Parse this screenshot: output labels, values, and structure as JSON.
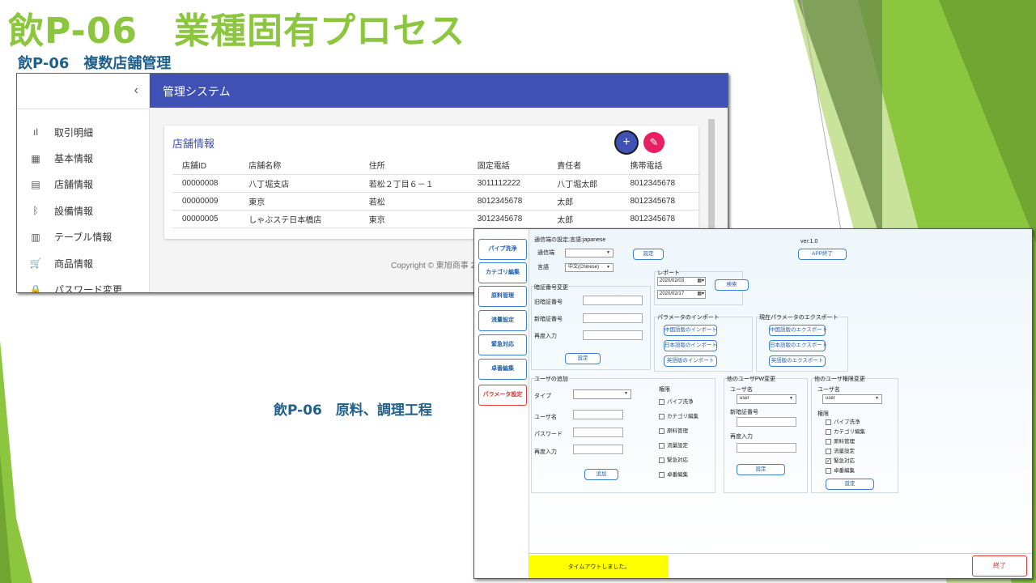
{
  "slide": {
    "title": "飲P-06　業種固有プロセス",
    "subtitle": "飲P-06　複数店舗管理",
    "caption2": "飲P-06　原料、調理工程"
  },
  "colors": {
    "title": "#8cc63f",
    "subtitle": "#1f5f8b",
    "header": "#3f51b5",
    "accent_pink": "#e91e63",
    "status_bar": "#ffff00"
  },
  "store_app": {
    "collapse_icon": "‹",
    "header_title": "管理システム",
    "nav": [
      {
        "icon": "bar-chart-icon",
        "glyph": "ıl",
        "label": "取引明細"
      },
      {
        "icon": "building-icon",
        "glyph": "▦",
        "label": "基本情報"
      },
      {
        "icon": "store-icon",
        "glyph": "▤",
        "label": "店舗情報"
      },
      {
        "icon": "bluetooth-icon",
        "glyph": "ᛒ",
        "label": "設備情報"
      },
      {
        "icon": "table-icon",
        "glyph": "▥",
        "label": "テーブル情報"
      },
      {
        "icon": "cart-icon",
        "glyph": "🛒",
        "label": "商品情報"
      },
      {
        "icon": "lock-icon",
        "glyph": "🔒",
        "label": "パスワード変更"
      }
    ],
    "card_title": "店舗情報",
    "add_label": "+",
    "edit_label": "✎",
    "columns": [
      "店舗ID",
      "店舗名称",
      "住所",
      "固定電話",
      "責任者",
      "携帯電話"
    ],
    "rows": [
      [
        "00000008",
        "八丁堀支店",
        "若松２丁目６－１",
        "3011112222",
        "八丁堀太郎",
        "8012345678"
      ],
      [
        "00000009",
        "東京",
        "若松",
        "8012345678",
        "太郎",
        "8012345678"
      ],
      [
        "00000005",
        "しゃぶステ日本橋店",
        "東京",
        "3012345678",
        "太郎",
        "8012345678"
      ]
    ],
    "footer": "Copyright © 東旭商事 20"
  },
  "param_app": {
    "left_buttons": [
      "パイプ洗浄",
      "カテゴリ編集",
      "原料管理",
      "流量設定",
      "緊急対応",
      "卓番編集",
      "パラメータ設定"
    ],
    "active_button": "パラメータ設定",
    "comm_settings": "通信端の設定;言語:japanese",
    "comm_port_label": "通信端",
    "comm_port_value": "",
    "set_label": "設定",
    "lang_label": "言語",
    "lang_value": "中文(Chinese)",
    "version": "ver:1.0",
    "app_exit": "APP終了",
    "report_label": "レポート",
    "date_from": "2020/02/03",
    "date_to": "2020/02/17",
    "search_label": "検索",
    "pw_change_title": "暗証番号変更",
    "old_pw_label": "旧暗証番号",
    "new_pw_label": "新暗証番号",
    "reenter_label": "再度入力",
    "param_import_title": "パラメータのインポート",
    "import_buttons": [
      "中国語版のインポート",
      "日本語版のインポート",
      "英語版のインポート"
    ],
    "param_export_title": "現在パラメータのエクスポート",
    "export_buttons": [
      "中国語版のエクスポート",
      "日本語版のエクスポート",
      "英語版のエクスポート"
    ],
    "add_user_title": "ユーザの追加",
    "type_label": "タイプ",
    "username_label": "ユーザ名",
    "password_label": "パスワード",
    "add_label": "追加",
    "permissions_label": "権限",
    "permissions": [
      "パイプ洗浄",
      "カテゴリ編集",
      "原料管理",
      "流量設定",
      "緊急対応",
      "卓番編集"
    ],
    "other_pw_title": "他のユーザPW変更",
    "user_value": "user",
    "other_perm_title": "他のユーザ権限変更",
    "other_permissions": [
      {
        "label": "パイプ洗浄",
        "checked": false
      },
      {
        "label": "カテゴリ編集",
        "checked": false
      },
      {
        "label": "原料管理",
        "checked": false
      },
      {
        "label": "流量設定",
        "checked": false
      },
      {
        "label": "緊急対応",
        "checked": true
      },
      {
        "label": "卓番編集",
        "checked": false
      }
    ],
    "status_message": "タイムアウトしました。",
    "exit_label": "終了"
  }
}
